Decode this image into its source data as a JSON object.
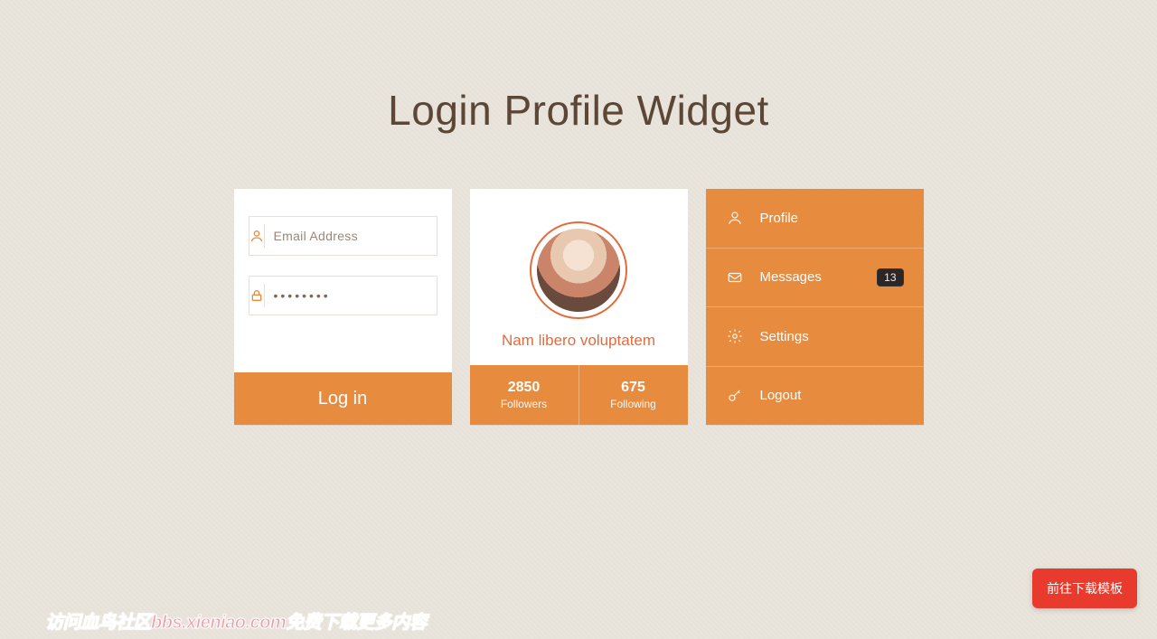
{
  "title": "Login Profile Widget",
  "login": {
    "email_placeholder": "Email Address",
    "password_value": "••••••••",
    "button": "Log in"
  },
  "profile": {
    "name": "Nam libero voluptatem",
    "stats": {
      "followers_count": "2850",
      "followers_label": "Followers",
      "following_count": "675",
      "following_label": "Following"
    }
  },
  "menu": {
    "items": [
      {
        "label": "Profile",
        "icon": "user-icon"
      },
      {
        "label": "Messages",
        "icon": "mail-icon",
        "badge": "13"
      },
      {
        "label": "Settings",
        "icon": "gear-icon"
      },
      {
        "label": "Logout",
        "icon": "key-icon"
      }
    ]
  },
  "watermark": "访问血鸟社区bbs.xieniao.com免费下载更多内容",
  "download_button": "前往下载模板",
  "colors": {
    "accent": "#e78b3f",
    "accent_dark": "#e56a3a",
    "badge_bg": "#2c2626",
    "danger": "#e83b2e",
    "bg": "#e9e4dc",
    "heading": "#5c4635"
  }
}
